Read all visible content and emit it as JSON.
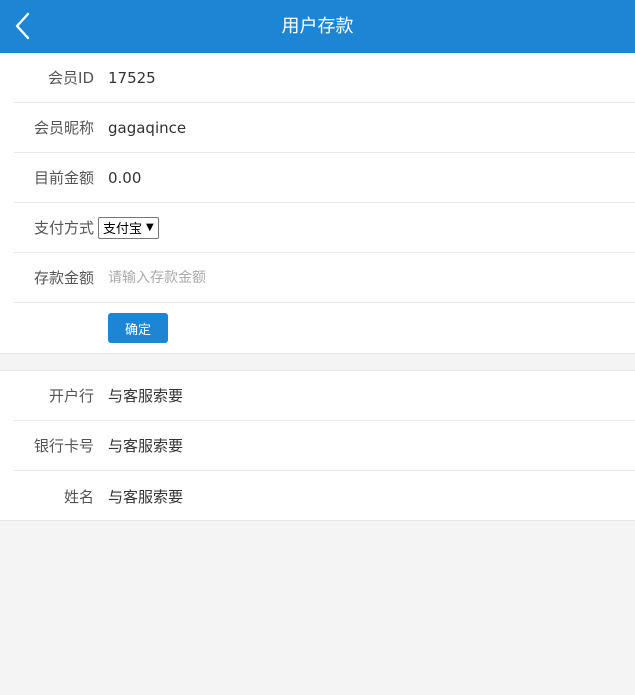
{
  "header": {
    "title": "用户存款",
    "back_icon": "chevron-left-icon"
  },
  "form": {
    "member_id": {
      "label": "会员ID",
      "value": "17525"
    },
    "nickname": {
      "label": "会员昵称",
      "value": "gagaqince"
    },
    "balance": {
      "label": "目前金额",
      "value": "0.00"
    },
    "payment_method": {
      "label": "支付方式",
      "selected": "支付宝"
    },
    "amount": {
      "label": "存款金额",
      "value": "",
      "placeholder": "请输入存款金额"
    },
    "confirm_label": "确定"
  },
  "bank_info": {
    "bank": {
      "label": "开户行",
      "value": "与客服索要"
    },
    "card_number": {
      "label": "银行卡号",
      "value": "与客服索要"
    },
    "name": {
      "label": "姓名",
      "value": "与客服索要"
    }
  },
  "colors": {
    "primary": "#1c86d5",
    "background": "#f4f4f4"
  }
}
